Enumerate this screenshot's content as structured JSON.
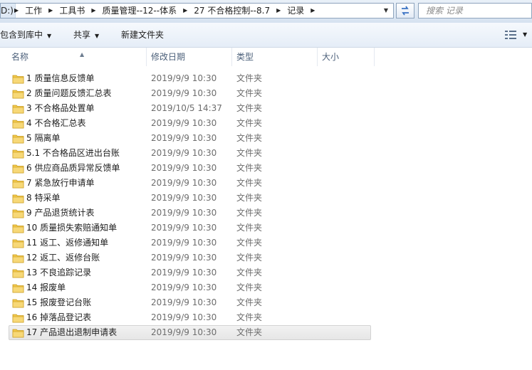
{
  "address": {
    "drive_label": "D:)",
    "crumbs": [
      {
        "label": "工作"
      },
      {
        "label": "工具书"
      },
      {
        "label": "质量管理--12--体系"
      },
      {
        "label": "27 不合格控制--8.7"
      },
      {
        "label": "记录"
      }
    ]
  },
  "search": {
    "placeholder": "搜索 记录"
  },
  "toolbar": {
    "include_library": "包含到库中",
    "share": "共享",
    "new_folder": "新建文件夹"
  },
  "columns": {
    "name": "名称",
    "date": "修改日期",
    "type": "类型",
    "size": "大小"
  },
  "files": [
    {
      "name": "1 质量信息反馈单",
      "date": "2019/9/9 10:30",
      "type": "文件夹"
    },
    {
      "name": "2 质量问题反馈汇总表",
      "date": "2019/9/9 10:30",
      "type": "文件夹"
    },
    {
      "name": "3 不合格品处置单",
      "date": "2019/10/5 14:37",
      "type": "文件夹"
    },
    {
      "name": "4 不合格汇总表",
      "date": "2019/9/9 10:30",
      "type": "文件夹"
    },
    {
      "name": "5 隔离单",
      "date": "2019/9/9 10:30",
      "type": "文件夹"
    },
    {
      "name": "5.1 不合格品区进出台账",
      "date": "2019/9/9 10:30",
      "type": "文件夹"
    },
    {
      "name": "6 供应商品质异常反馈单",
      "date": "2019/9/9 10:30",
      "type": "文件夹"
    },
    {
      "name": "7 紧急放行申请单",
      "date": "2019/9/9 10:30",
      "type": "文件夹"
    },
    {
      "name": "8 特采单",
      "date": "2019/9/9 10:30",
      "type": "文件夹"
    },
    {
      "name": "9 产品退货统计表",
      "date": "2019/9/9 10:30",
      "type": "文件夹"
    },
    {
      "name": "10 质量损失索赔通知单",
      "date": "2019/9/9 10:30",
      "type": "文件夹"
    },
    {
      "name": "11 返工、返修通知单",
      "date": "2019/9/9 10:30",
      "type": "文件夹"
    },
    {
      "name": "12 返工、返修台账",
      "date": "2019/9/9 10:30",
      "type": "文件夹"
    },
    {
      "name": "13 不良追踪记录",
      "date": "2019/9/9 10:30",
      "type": "文件夹"
    },
    {
      "name": "14 报废单",
      "date": "2019/9/9 10:30",
      "type": "文件夹"
    },
    {
      "name": "15 报废登记台账",
      "date": "2019/9/9 10:30",
      "type": "文件夹"
    },
    {
      "name": "16 掉落品登记表",
      "date": "2019/9/9 10:30",
      "type": "文件夹"
    },
    {
      "name": "17 产品退出退制申请表",
      "date": "2019/9/9 10:30",
      "type": "文件夹",
      "selected": true
    }
  ],
  "colors": {
    "folder": "#f2c94c",
    "header_text": "#4c607a",
    "selection": "#e6e6e6"
  }
}
